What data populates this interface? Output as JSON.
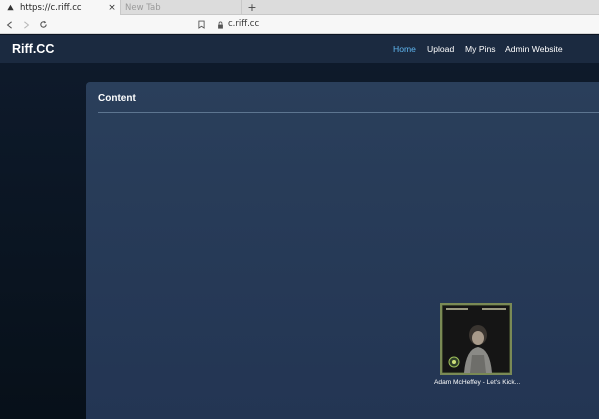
{
  "browser": {
    "active_tab": "https://c.riff.cc",
    "inactive_tab": "New Tab",
    "new_tab_symbol": "+",
    "close_symbol": "×",
    "url": "c.riff.cc",
    "icons": [
      "warning-icon",
      "close-icon",
      "back-icon",
      "forward-icon",
      "reload-icon",
      "bookmark-icon",
      "lock-icon"
    ]
  },
  "site": {
    "brand": "Riff.CC",
    "nav": [
      {
        "label": "Home",
        "active": true
      },
      {
        "label": "Upload",
        "active": false
      },
      {
        "label": "My Pins",
        "active": false
      },
      {
        "label": "Admin Website",
        "active": false
      }
    ],
    "accent_color": "#5fb6f0"
  },
  "main": {
    "section_title": "Content",
    "items": [
      {
        "title": "Adam McHeffey - Let's Kick..."
      }
    ]
  }
}
